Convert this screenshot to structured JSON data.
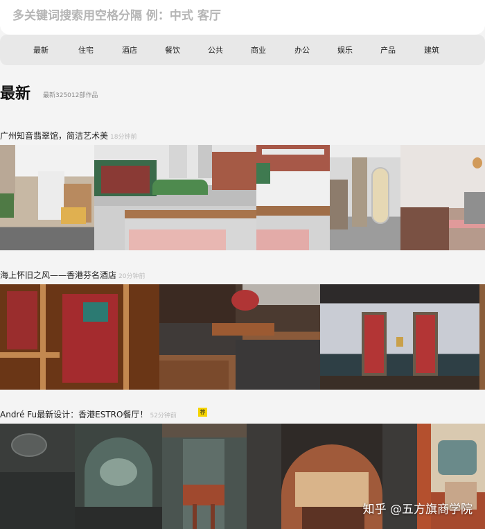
{
  "search": {
    "placeholder": "多关键词搜索用空格分隔 例：中式 客厅"
  },
  "nav": {
    "items": [
      "最新",
      "住宅",
      "酒店",
      "餐饮",
      "公共",
      "商业",
      "办公",
      "娱乐",
      "产品",
      "建筑"
    ]
  },
  "section": {
    "title": "最新",
    "count": "最新325012部作品"
  },
  "projects": [
    {
      "title": "广州知音翡翠馆，简洁艺术美",
      "time": "18分钟前"
    },
    {
      "title": "海上怀旧之风——香港芬名酒店",
      "time": "20分钟前"
    },
    {
      "title": "André Fu最新设计：香港ESTRO餐厅！",
      "time": "52分钟前",
      "badge": "荐"
    }
  ],
  "watermark": "知乎 @五方旗商学院"
}
